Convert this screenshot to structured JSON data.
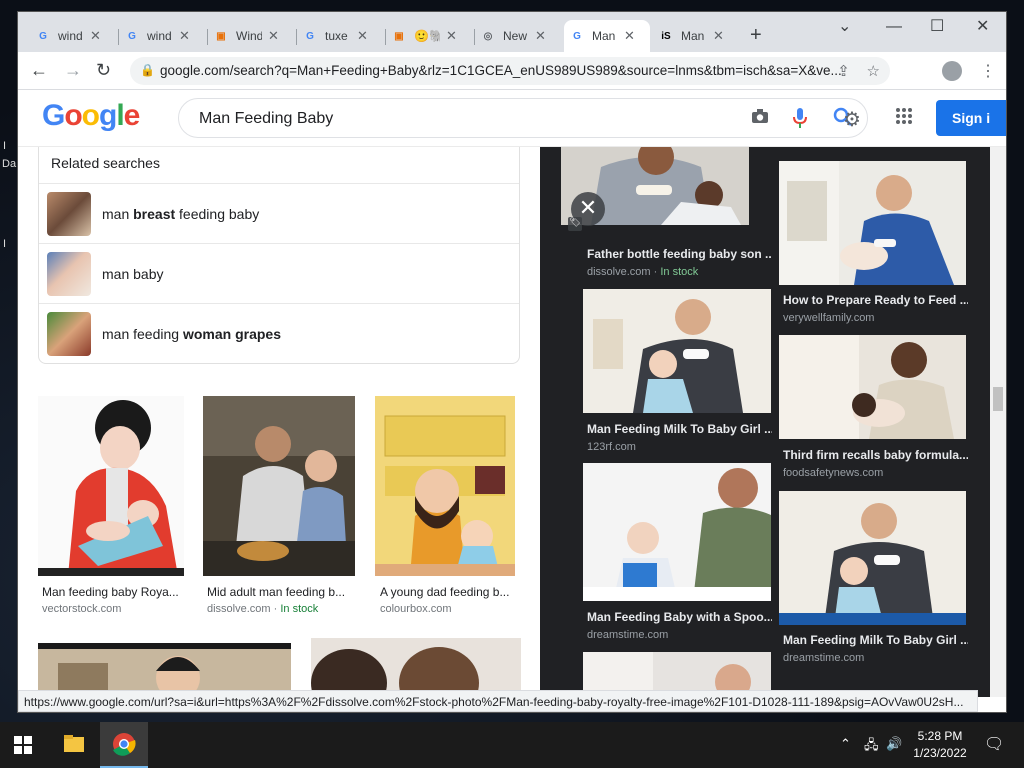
{
  "desktop": {
    "fragments": [
      "I",
      "Da",
      "I"
    ]
  },
  "browser": {
    "tabs": [
      {
        "label": "wind",
        "favicon": "google-icon",
        "color": "#4285f4",
        "glyph": "G"
      },
      {
        "label": "wind",
        "favicon": "google-icon",
        "color": "#4285f4",
        "glyph": "G"
      },
      {
        "label": "Wind",
        "favicon": "site-icon",
        "color": "#e8710a",
        "glyph": "▣"
      },
      {
        "label": "tuxe",
        "favicon": "google-icon",
        "color": "#4285f4",
        "glyph": "G"
      },
      {
        "label": "🙂🐘",
        "favicon": "site-icon",
        "color": "#e8710a",
        "glyph": "▣"
      },
      {
        "label": "New",
        "favicon": "chrome-icon",
        "color": "#5f6368",
        "glyph": "◎"
      },
      {
        "label": "Man",
        "favicon": "google-icon",
        "color": "#4285f4",
        "glyph": "G"
      },
      {
        "label": "Man",
        "favicon": "istock-icon",
        "color": "#000000",
        "glyph": "iS"
      }
    ],
    "active_tab": 6,
    "new_tab": "+",
    "window_controls": {
      "chevron": "⌄",
      "minimize": "—",
      "maximize": "☐",
      "close": "✕"
    },
    "nav": {
      "back": "←",
      "forward": "→",
      "reload": "↻"
    },
    "url": "google.com/search?q=Man+Feeding+Baby&rlz=1C1GCEA_enUS989US989&source=lnms&tbm=isch&sa=X&ve...",
    "status_url": "https://www.google.com/url?sa=i&url=https%3A%2F%2Fdissolve.com%2Fstock-photo%2FMan-feeding-baby-royalty-free-image%2F101-D1028-111-189&psig=AOvVaw0U2sH..."
  },
  "google": {
    "logo": [
      {
        "ch": "G",
        "color": "#4285f4"
      },
      {
        "ch": "o",
        "color": "#ea4335"
      },
      {
        "ch": "o",
        "color": "#fbbc05"
      },
      {
        "ch": "g",
        "color": "#4285f4"
      },
      {
        "ch": "l",
        "color": "#34a853"
      },
      {
        "ch": "e",
        "color": "#ea4335"
      }
    ],
    "query": "Man Feeding Baby",
    "sign_in": "Sign i",
    "accent": "#1a73e8"
  },
  "related": {
    "title": "Related searches",
    "items": [
      {
        "pre": "man ",
        "bold": "breast",
        "post": " feeding baby"
      },
      {
        "pre": "man baby",
        "bold": "",
        "post": ""
      },
      {
        "pre": "man feeding ",
        "bold": "woman grapes",
        "post": ""
      }
    ]
  },
  "results": [
    {
      "caption": "Man feeding baby Roya...",
      "source": "vectorstock.com",
      "stock": ""
    },
    {
      "caption": "Mid adult man feeding b...",
      "source": "dissolve.com",
      "stock": "In stock"
    },
    {
      "caption": "A young dad feeding b...",
      "source": "colourbox.com",
      "stock": ""
    }
  ],
  "panel": {
    "close": "✕",
    "items": [
      {
        "caption": "Father bottle feeding baby son ...",
        "source": "dissolve.com",
        "stock": "In stock"
      },
      {
        "caption": "How to Prepare Ready to Feed ...",
        "source": "verywellfamily.com",
        "stock": ""
      },
      {
        "caption": "Man Feeding Milk To Baby Girl ...",
        "source": "123rf.com",
        "stock": ""
      },
      {
        "caption": "Third firm recalls baby formula...",
        "source": "foodsafetynews.com",
        "stock": ""
      },
      {
        "caption": "Man Feeding Baby with a Spoo...",
        "source": "dreamstime.com",
        "stock": ""
      },
      {
        "caption": "Man Feeding Milk To Baby Girl ...",
        "source": "dreamstime.com",
        "stock": ""
      }
    ]
  },
  "taskbar": {
    "time": "5:28 PM",
    "date": "1/23/2022",
    "tray_icons": [
      "chevron-up-icon",
      "network-icon",
      "volume-icon"
    ]
  }
}
